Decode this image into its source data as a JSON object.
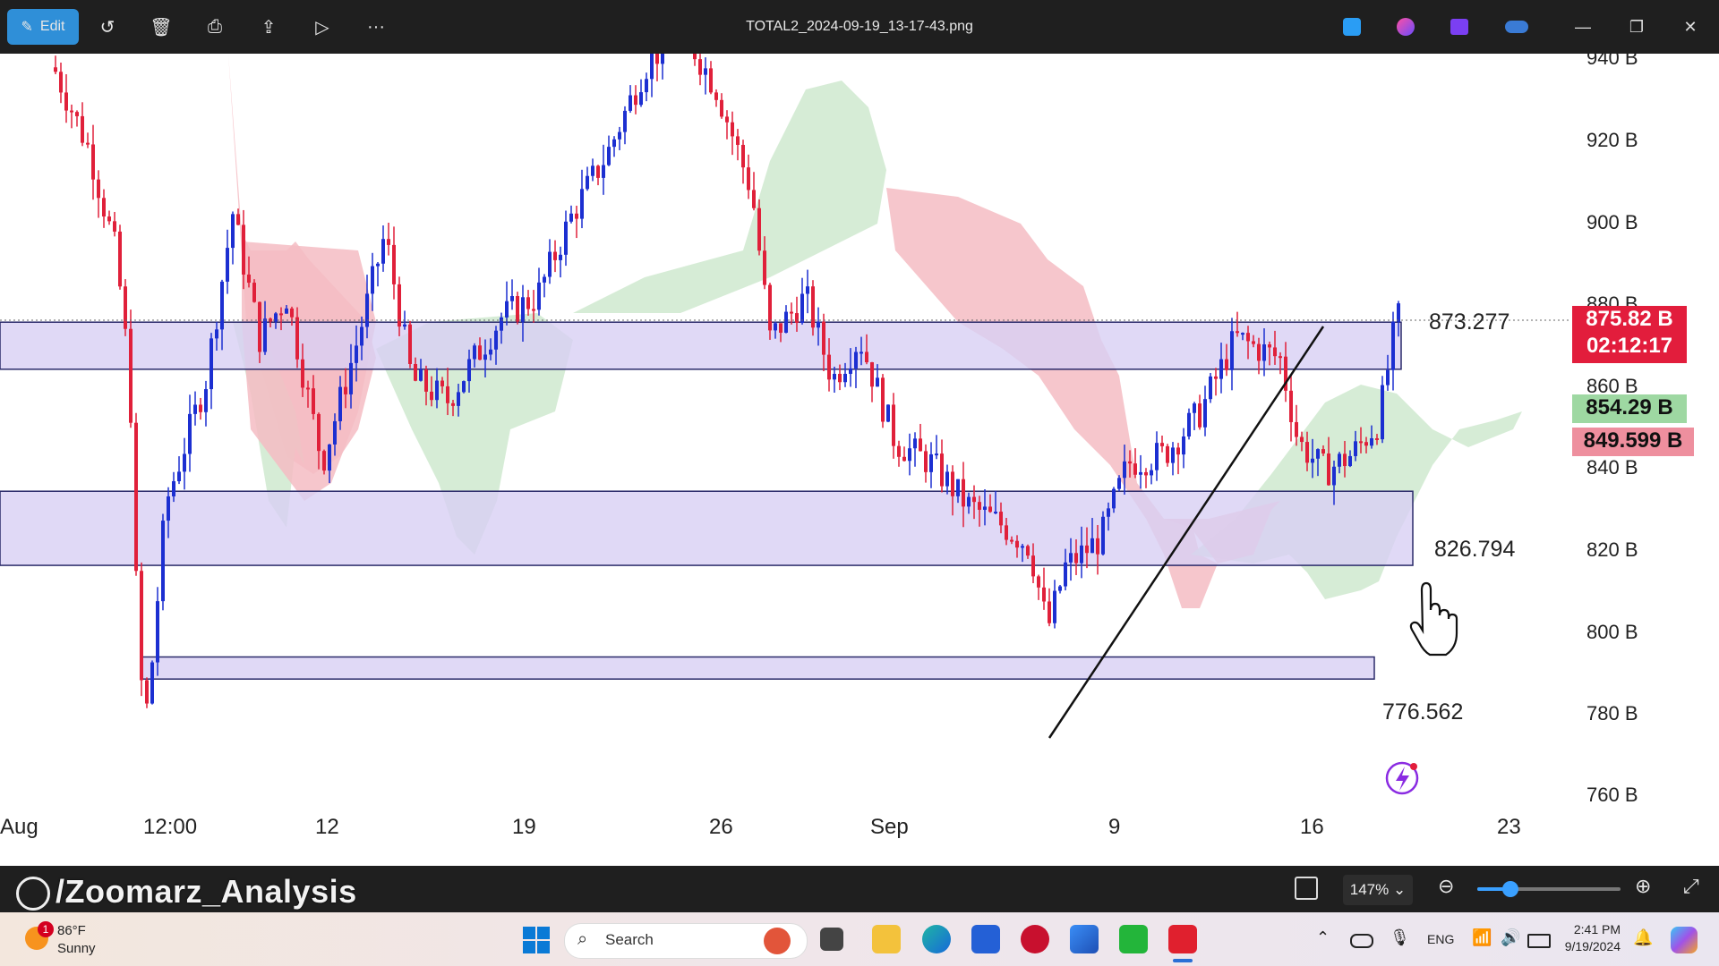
{
  "window": {
    "title": "TOTAL2_2024-09-19_13-17-43.png",
    "edit_label": "Edit"
  },
  "chart": {
    "y_ticks": [
      "940 B",
      "920 B",
      "900 B",
      "880 B",
      "860 B",
      "840 B",
      "820 B",
      "800 B",
      "780 B",
      "760 B"
    ],
    "x_ticks": [
      "Aug",
      "12:00",
      "12",
      "19",
      "26",
      "Sep",
      "9",
      "16",
      "23"
    ],
    "levels": {
      "resistance": "873.277",
      "support_mid": "826.794",
      "support_low": "776.562"
    },
    "badges": {
      "price": "875.82 B",
      "countdown": "02:12:17",
      "green": "854.29 B",
      "red": "849.599 B"
    },
    "colors": {
      "zone": "#d8d0f4",
      "cloud_green": "#cfe9cf",
      "cloud_red": "#f4bcc3",
      "bull": "#1c2fd1",
      "bear": "#e0203a",
      "badge_price": "#e21d3c",
      "badge_green": "#9ed8a2",
      "badge_red": "#ee8f9e"
    }
  },
  "viewer": {
    "zoom": "147%",
    "watermark": "/Zoomarz_Analysis"
  },
  "taskbar": {
    "weather_temp": "86°F",
    "weather_desc": "Sunny",
    "weather_alert": "1",
    "search": "Search",
    "lang": "ENG",
    "time": "2:41 PM",
    "date": "9/19/2024"
  }
}
